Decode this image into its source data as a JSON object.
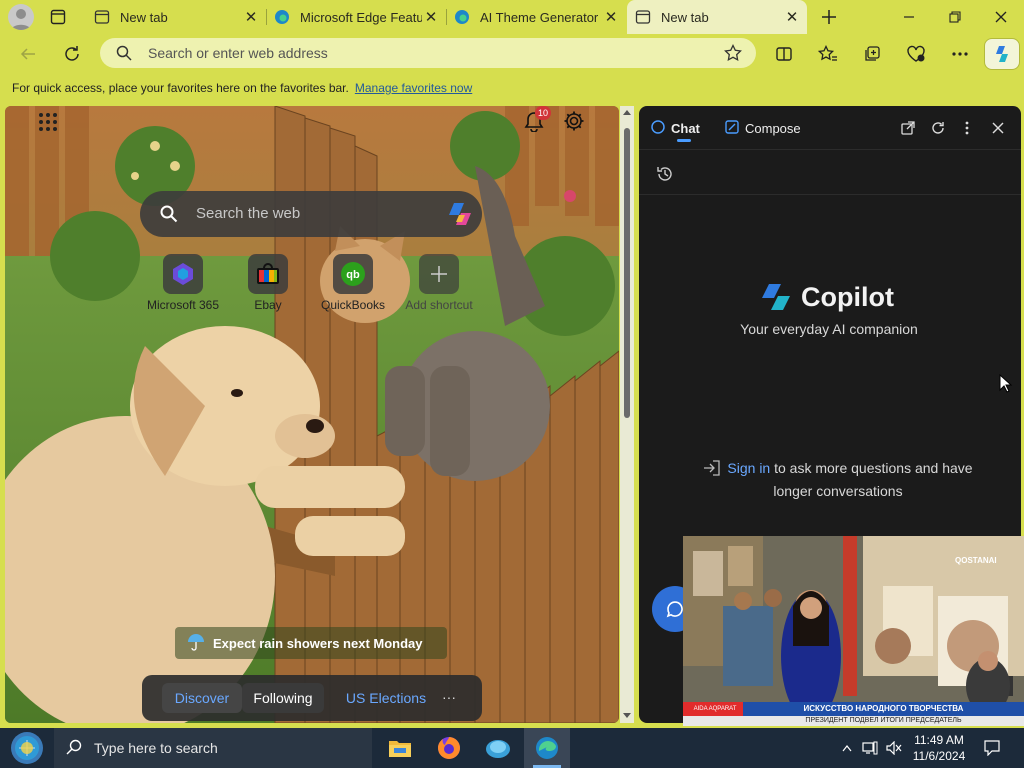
{
  "tabs": [
    {
      "title": "New tab"
    },
    {
      "title": "Microsoft Edge Featu"
    },
    {
      "title": "AI Theme Generator"
    },
    {
      "title": "New tab"
    }
  ],
  "address_bar": {
    "placeholder": "Search or enter web address"
  },
  "favorites_bar": {
    "message": "For quick access, place your favorites here on the favorites bar.",
    "link": "Manage favorites now"
  },
  "new_tab_page": {
    "search_placeholder": "Search the web",
    "notification_count": "10",
    "shortcuts": [
      {
        "label": "Microsoft 365"
      },
      {
        "label": "Ebay"
      },
      {
        "label": "QuickBooks"
      },
      {
        "label": "Add shortcut"
      }
    ],
    "weather_text": "Expect rain showers next Monday",
    "feed_tabs": [
      "Discover",
      "Following",
      "US Elections"
    ],
    "more_label": "···"
  },
  "copilot": {
    "tabs": [
      "Chat",
      "Compose"
    ],
    "title": "Copilot",
    "tagline": "Your everyday AI companion",
    "signin_link": "Sign in",
    "signin_text": "to ask more questions and have longer conversations"
  },
  "video_overlay": {
    "caption": "ИСКУССТВО НАРОДНОГО ТВОРЧЕСТВА",
    "ticker": "ПРЕЗИДЕНТ ПОДВЕЛ ИТОГИ ПРЕДСЕДАТЕЛЬ",
    "logo": "QOSTANAI",
    "badge": "AIDA AQPARAT"
  },
  "taskbar": {
    "search_placeholder": "Type here to search",
    "time": "11:49 AM",
    "date": "11/6/2024"
  },
  "colors": {
    "theme": "#d6de4e",
    "copilot_bg": "#1b1b1b",
    "link": "#6aa8ff"
  }
}
